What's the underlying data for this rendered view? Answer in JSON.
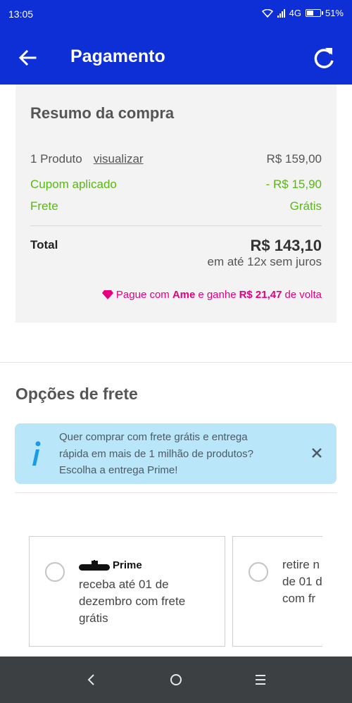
{
  "status_bar": {
    "time": "13:05",
    "network": "4G",
    "battery": "51%",
    "battery_level": 0.51
  },
  "app_bar": {
    "title": "Pagamento",
    "back_icon": "arrow-left-icon",
    "refresh_icon": "refresh-icon"
  },
  "summary": {
    "title": "Resumo da compra",
    "product_label": "1 Produto",
    "view_link": "visualizar",
    "product_value": "R$ 159,00",
    "coupon_label": "Cupom aplicado",
    "coupon_value": "- R$ 15,90",
    "shipping_label": "Frete",
    "shipping_value": "Grátis",
    "total_label": "Total",
    "total_value": "R$ 143,10",
    "installments": "em até 12x sem juros",
    "ame_prefix": "Pague com",
    "ame_brand": "Ame",
    "ame_middle": "e ganhe",
    "ame_cashback": "R$ 21,47",
    "ame_suffix": "de volta",
    "ame_icon": "diamond-icon",
    "colors": {
      "green": "#5ab812",
      "pink": "#e6007e"
    }
  },
  "shipping": {
    "title": "Opções de frete",
    "info": {
      "line1": "Quer comprar com frete grátis e entrega",
      "line2": "rápida em mais de 1 milhão de produtos?",
      "line3": "Escolha a entrega Prime!",
      "icon": "info-icon",
      "close_icon": "close-icon"
    },
    "options": [
      {
        "badge": "Prime",
        "badge_icon": "submarine-icon",
        "line1": "receba até 01 de",
        "line2": "dezembro com frete",
        "line3": "grátis"
      },
      {
        "line1": "retire n",
        "line2": "de 01 d",
        "line3": "com fr"
      }
    ]
  },
  "nav_bar": {
    "back_icon": "chevron-left-icon",
    "home_icon": "circle-home-icon",
    "menu_icon": "menu-lines-icon"
  },
  "colors": {
    "primary": "#0e2fd6",
    "info_bg": "#b9e6f8",
    "nav_bg": "#3c4043"
  }
}
